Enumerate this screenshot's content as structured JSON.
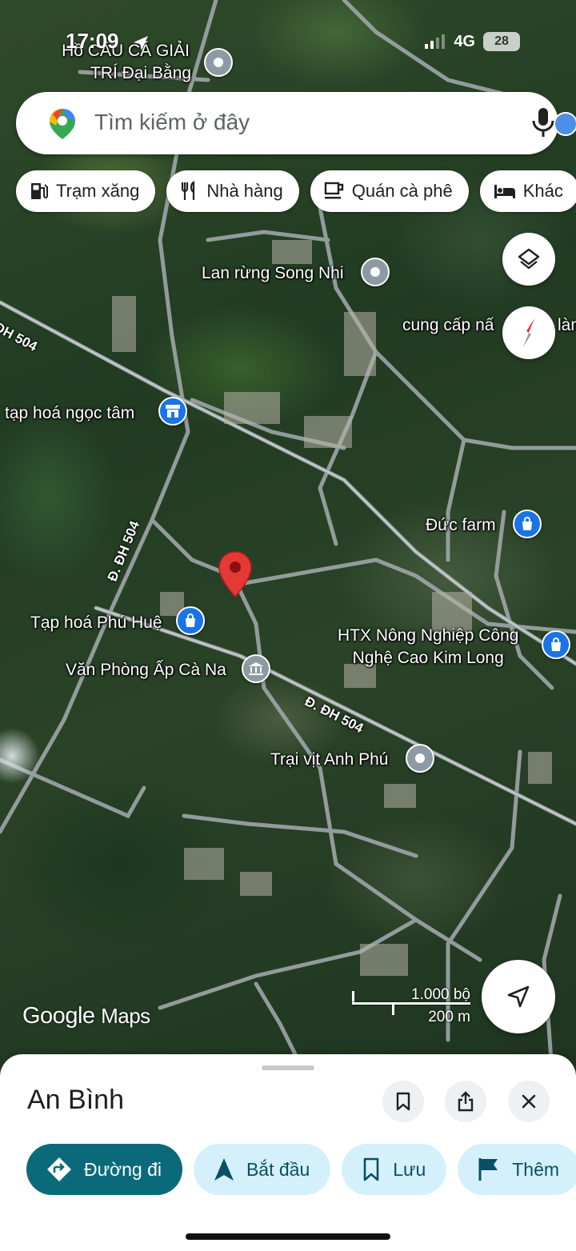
{
  "status_bar": {
    "time": "17:09",
    "network": "4G",
    "battery": "28"
  },
  "search": {
    "placeholder": "Tìm kiếm ở đây"
  },
  "chips": [
    "Trạm xăng",
    "Nhà hàng",
    "Quán cà phê",
    "Khác"
  ],
  "map": {
    "places": [
      {
        "name": "Hồ CÂU CÁ GIẢI TRÍ Đại Bằng",
        "lines": [
          "Hồ CÂU CÁ GIẢI",
          "TRÍ Đại Bằng"
        ],
        "icon": "place-pin-icon"
      },
      {
        "name": "Lan rừng Song Nhi",
        "icon": "place-pin-icon"
      },
      {
        "name": "cung cấp nấ... làm",
        "text_left": "cung cấp nấ",
        "text_right": "làm",
        "icon": "place-pin-icon"
      },
      {
        "name": "tạp hoá ngọc tâm",
        "icon": "store-icon"
      },
      {
        "name": "Đức farm",
        "icon": "shopping-bag-icon"
      },
      {
        "name": "Tạp hoá Phú Huệ",
        "icon": "shopping-bag-icon"
      },
      {
        "name": "HTX Nông Nghiệp Công Nghệ Cao Kim Long",
        "lines": [
          "HTX Nông Nghiệp Công",
          "Nghệ Cao Kim Long"
        ],
        "icon": "shopping-bag-icon"
      },
      {
        "name": "Văn Phòng Ấp Cà Na",
        "icon": "government-building-icon"
      },
      {
        "name": "Trại vịt Anh Phú",
        "icon": "place-pin-icon"
      }
    ],
    "road_labels": [
      "ĐH 504",
      "Đ. ĐH 504",
      "Đ. ĐH 504"
    ],
    "scale": {
      "imperial": "1.000 bộ",
      "metric": "200 m"
    },
    "attribution": {
      "google": "Google",
      "maps": "Maps"
    },
    "selected_marker_icon": "red-map-pin-icon"
  },
  "place_sheet": {
    "title": "An Bình",
    "actions": [
      "Đường đi",
      "Bắt đầu",
      "Lưu",
      "Thêm"
    ]
  },
  "colors": {
    "primary_action": "#0b6a7a",
    "secondary_action": "#d4f1fb",
    "pin_blue": "#1a73e8",
    "pin_gray": "#8e9aa3",
    "marker_red": "#e53935"
  }
}
